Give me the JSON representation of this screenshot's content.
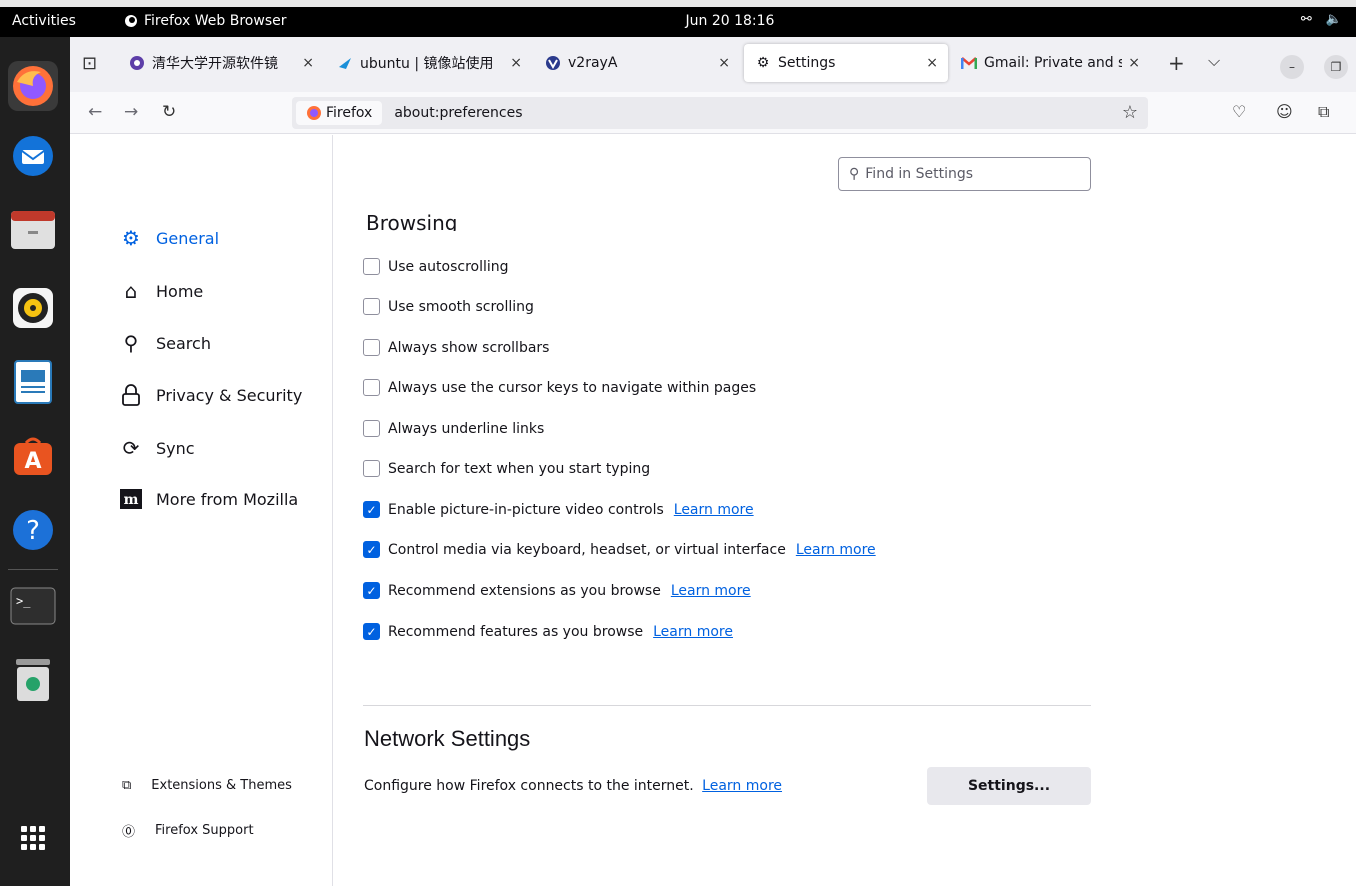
{
  "topbar": {
    "activities": "Activities",
    "app_name": "Firefox Web Browser",
    "clock": "Jun 20  18:16"
  },
  "dock": {
    "items": [
      "firefox",
      "thunderbird",
      "files",
      "rhythmbox",
      "libreoffice-writer",
      "app-center",
      "help",
      "terminal",
      "trash",
      "show-apps"
    ]
  },
  "tabs": [
    {
      "label": "清华大学开源软件镜",
      "favicon": "tuna-icon"
    },
    {
      "label": "ubuntu | 镜像站使用",
      "favicon": "tuna-bird-icon"
    },
    {
      "label": "v2rayA",
      "favicon": "v2raya-icon"
    },
    {
      "label": "Settings",
      "favicon": "gear-icon",
      "selected": true
    },
    {
      "label": "Gmail: Private and s",
      "favicon": "gmail-icon"
    }
  ],
  "navbar": {
    "identity": "Firefox",
    "url": "about:preferences"
  },
  "sidebar": {
    "categories": [
      {
        "label": "General",
        "selected": true
      },
      {
        "label": "Home"
      },
      {
        "label": "Search"
      },
      {
        "label": "Privacy & Security"
      },
      {
        "label": "Sync"
      },
      {
        "label": "More from Mozilla"
      }
    ],
    "footer": [
      "Extensions & Themes",
      "Firefox Support"
    ]
  },
  "search": {
    "placeholder": "Find in Settings"
  },
  "browsing": {
    "heading": "Browsing",
    "options": [
      {
        "label": "Use autoscrolling",
        "checked": false
      },
      {
        "label": "Use smooth scrolling",
        "checked": false
      },
      {
        "label": "Always show scrollbars",
        "checked": false
      },
      {
        "label": "Always use the cursor keys to navigate within pages",
        "checked": false
      },
      {
        "label": "Always underline links",
        "checked": false
      },
      {
        "label": "Search for text when you start typing",
        "checked": false
      },
      {
        "label": "Enable picture-in-picture video controls",
        "checked": true,
        "link": "Learn more"
      },
      {
        "label": "Control media via keyboard, headset, or virtual interface",
        "checked": true,
        "link": "Learn more"
      },
      {
        "label": "Recommend extensions as you browse",
        "checked": true,
        "link": "Learn more"
      },
      {
        "label": "Recommend features as you browse",
        "checked": true,
        "link": "Learn more"
      }
    ]
  },
  "network": {
    "heading": "Network Settings",
    "description": "Configure how Firefox connects to the internet.",
    "link": "Learn more",
    "button": "Settings..."
  },
  "colors": {
    "accent": "#0061e0",
    "topbar": "#000000",
    "dock": "#1f1f1f"
  }
}
